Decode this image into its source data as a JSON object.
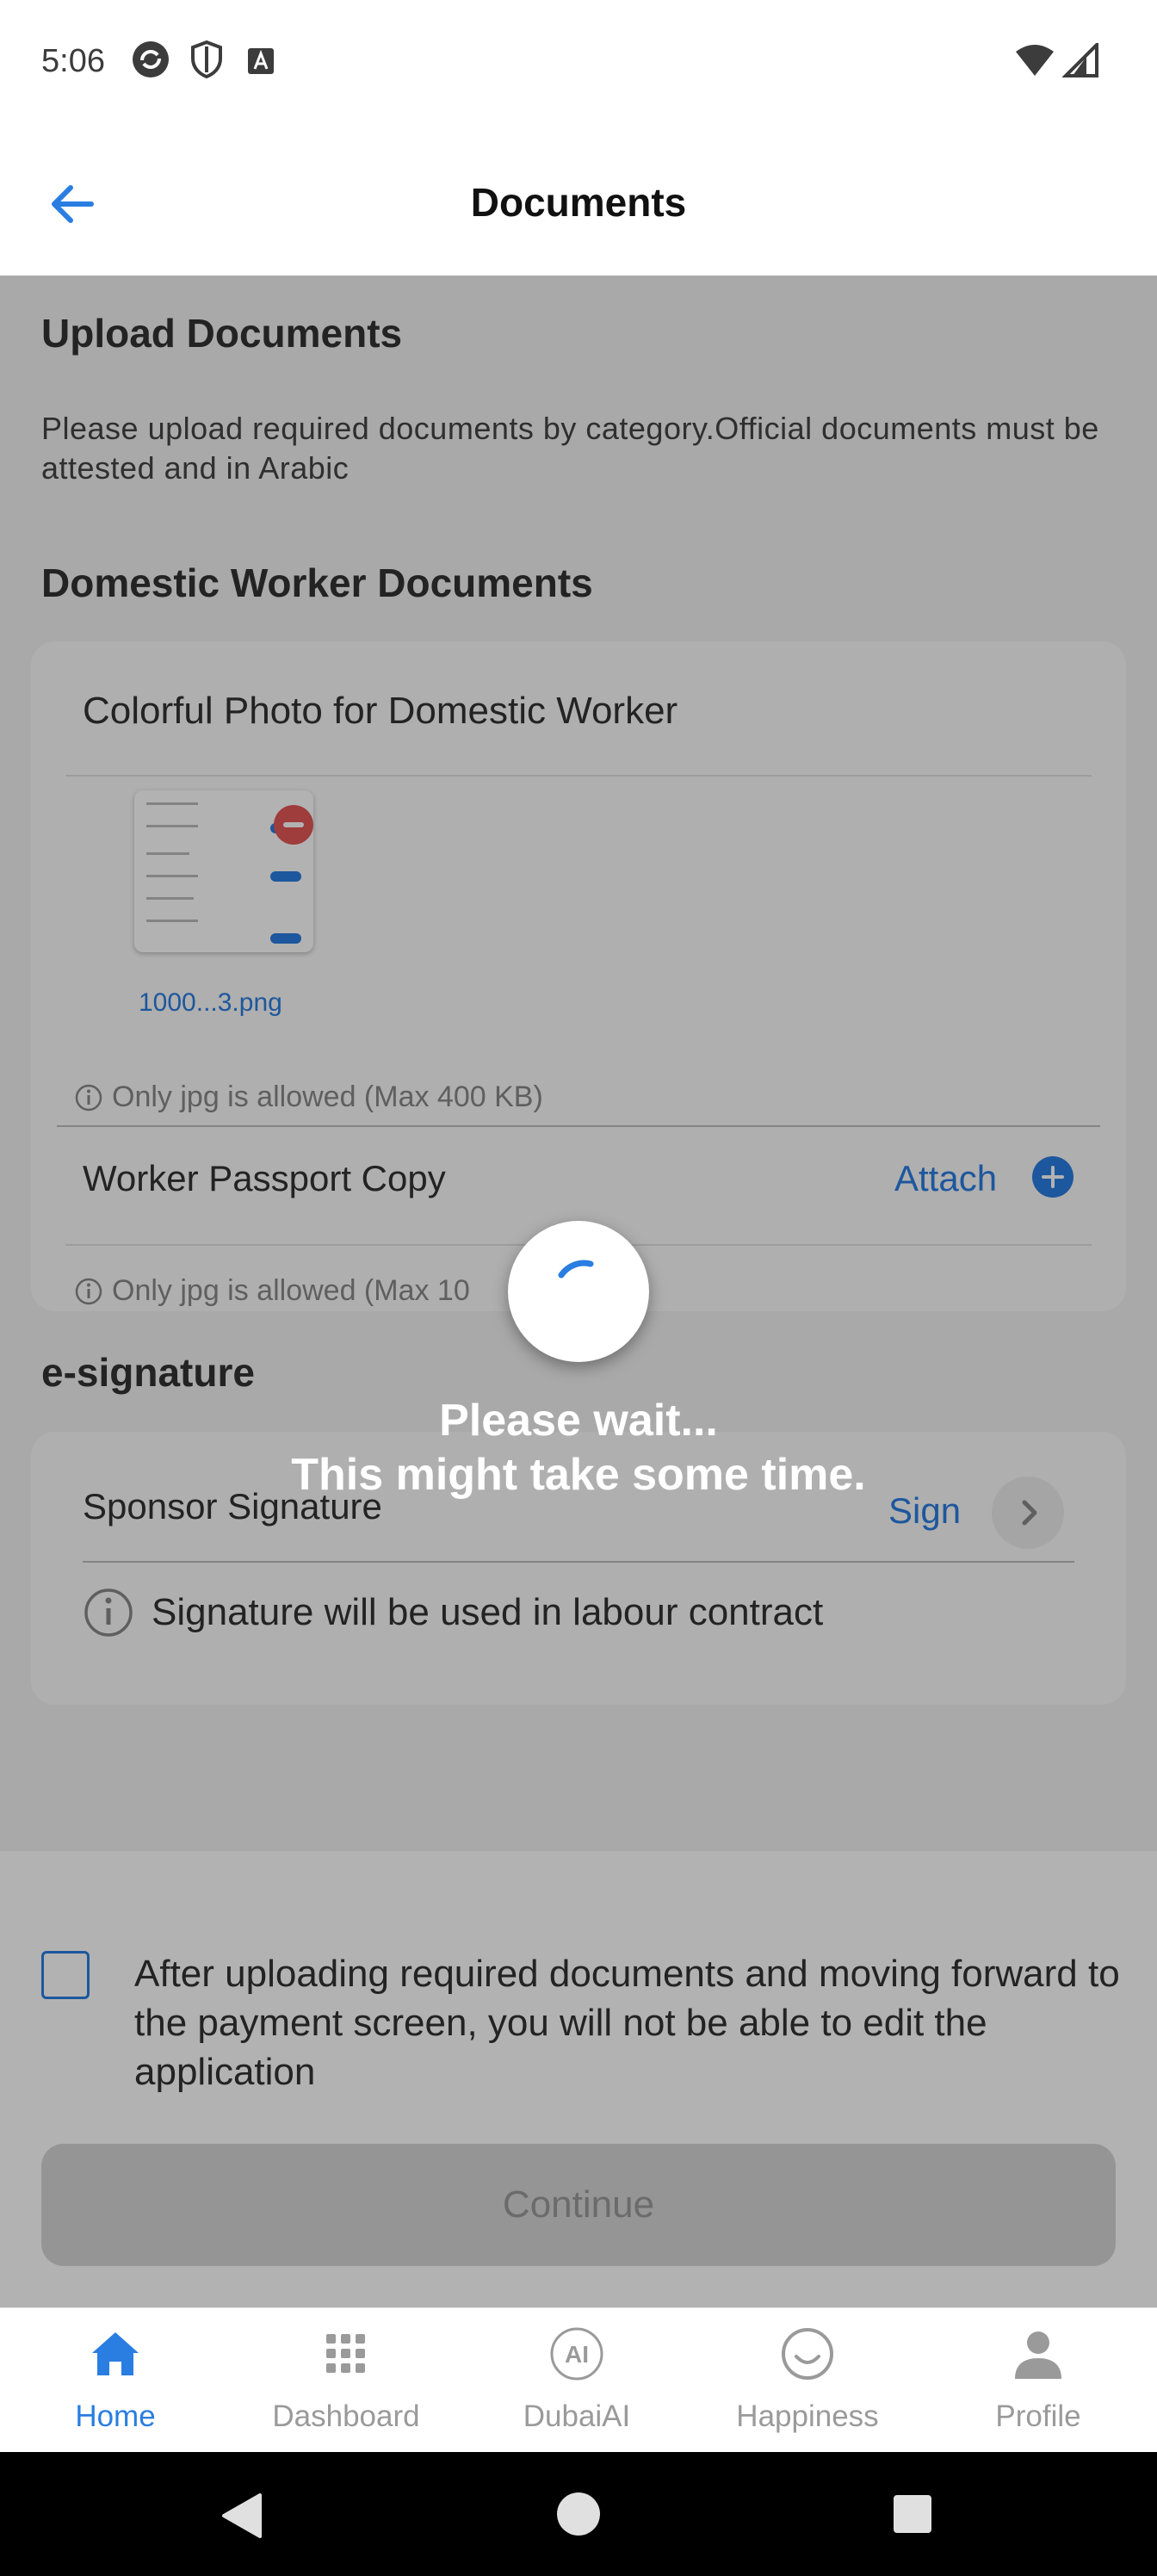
{
  "status_bar": {
    "time": "5:06"
  },
  "app_bar": {
    "title": "Documents"
  },
  "upload_section": {
    "title": "Upload Documents",
    "description": "Please upload required documents by category.Official documents must be attested and in Arabic"
  },
  "worker_docs": {
    "title": "Domestic Worker Documents",
    "photo": {
      "label": "Colorful Photo for Domestic Worker",
      "file_name": "1000...3.png",
      "hint": "Only jpg is allowed (Max 400 KB)"
    },
    "passport": {
      "label": "Worker Passport Copy",
      "action": "Attach",
      "hint": "Only jpg is allowed (Max 10"
    }
  },
  "esignature": {
    "title": "e-signature",
    "label": "Sponsor Signature",
    "action": "Sign",
    "info": "Signature will be used in labour contract"
  },
  "consent": {
    "text": "After uploading required documents and moving forward to the payment screen, you will not be able to edit the application"
  },
  "continue_label": "Continue",
  "loading": {
    "line1": "Please wait...",
    "line2": "This might take some time."
  },
  "bottom_nav": [
    {
      "label": "Home",
      "icon": "home-icon",
      "active": true
    },
    {
      "label": "Dashboard",
      "icon": "grid-icon"
    },
    {
      "label": "DubaiAI",
      "icon": "ai-icon"
    },
    {
      "label": "Happiness",
      "icon": "smiley-icon"
    },
    {
      "label": "Profile",
      "icon": "person-icon"
    }
  ],
  "colors": {
    "accent": "#2a7de1",
    "danger": "#e45656"
  }
}
